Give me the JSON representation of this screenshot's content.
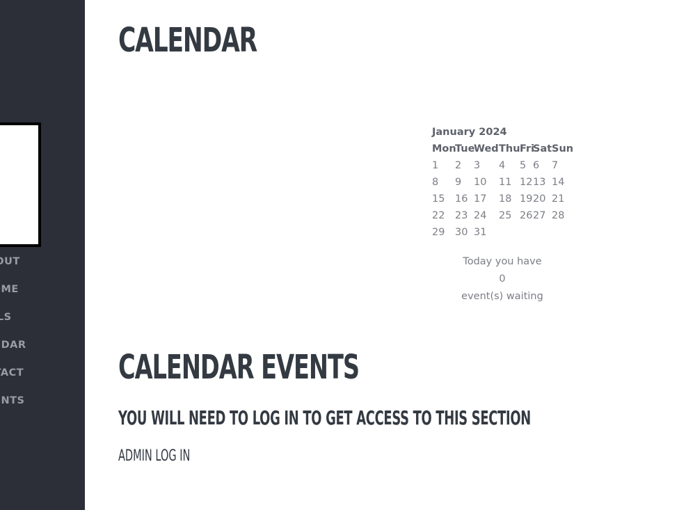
{
  "sidebar": {
    "nav": [
      {
        "label": "ABOUT"
      },
      {
        "label": "HOME"
      },
      {
        "label": "DETAILS"
      },
      {
        "label": "CALENDAR"
      },
      {
        "label": "CONTACT"
      },
      {
        "label": "EVENTS"
      }
    ]
  },
  "main": {
    "title": "CALENDAR",
    "calendar": {
      "month": "January 2024",
      "weekdays": [
        "Mon",
        "Tue",
        "Wed",
        "Thu",
        "Fri",
        "Sat",
        "Sun"
      ],
      "weeks": [
        [
          "1",
          "2",
          "3",
          "4",
          "5",
          "6",
          "7"
        ],
        [
          "8",
          "9",
          "10",
          "11",
          "12",
          "13",
          "14"
        ],
        [
          "15",
          "16",
          "17",
          "18",
          "19",
          "20",
          "21"
        ],
        [
          "22",
          "23",
          "24",
          "25",
          "26",
          "27",
          "28"
        ],
        [
          "29",
          "30",
          "31",
          "",
          "",
          "",
          ""
        ]
      ]
    },
    "events_summary": {
      "line1": "Today you have",
      "count": "0",
      "line2": "event(s) waiting"
    },
    "events_title": "CALENDAR EVENTS",
    "login_notice": "YOU WILL NEED TO LOG IN TO GET ACCESS TO THIS SECTION",
    "admin_link": "ADMIN LOG IN"
  },
  "colors": {
    "sidebar_bg": "#2c2e38",
    "heading": "#343a42",
    "text_muted": "#7b7e85",
    "nav_text": "#9a9ca3"
  }
}
